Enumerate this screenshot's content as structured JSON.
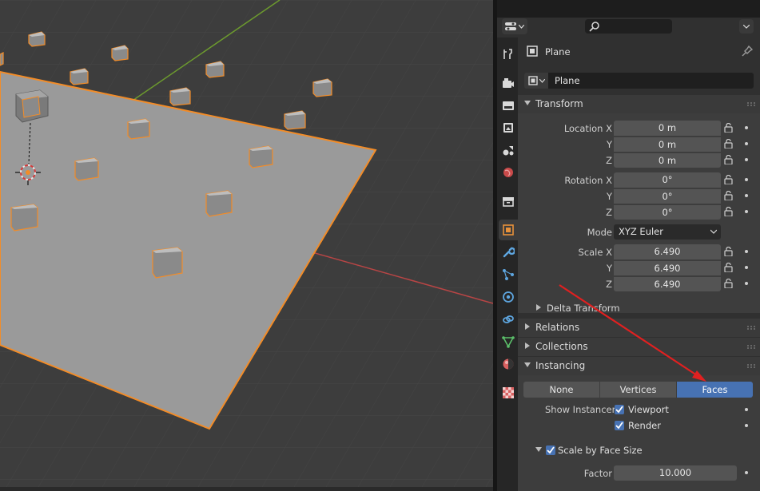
{
  "object": {
    "name": "Plane",
    "datablock_name": "Plane"
  },
  "tabs": [
    {
      "id": "tool",
      "icon": "tool-icon"
    },
    {
      "id": "render",
      "icon": "render-icon"
    },
    {
      "id": "output",
      "icon": "output-icon"
    },
    {
      "id": "view-layer",
      "icon": "view-layer-icon"
    },
    {
      "id": "scene",
      "icon": "scene-icon"
    },
    {
      "id": "world",
      "icon": "world-icon"
    },
    {
      "id": "collection",
      "icon": "collection-icon"
    },
    {
      "id": "object",
      "icon": "object-icon",
      "active": true
    },
    {
      "id": "modifiers",
      "icon": "wrench-icon"
    },
    {
      "id": "particles",
      "icon": "particles-icon"
    },
    {
      "id": "physics",
      "icon": "physics-icon"
    },
    {
      "id": "constraints",
      "icon": "constraints-icon"
    },
    {
      "id": "data",
      "icon": "mesh-data-icon"
    },
    {
      "id": "material",
      "icon": "material-icon"
    },
    {
      "id": "texture",
      "icon": "texture-icon"
    }
  ],
  "transform": {
    "title": "Transform",
    "location": {
      "label": "Location X",
      "y_label": "Y",
      "z_label": "Z",
      "x": "0 m",
      "y": "0 m",
      "z": "0 m"
    },
    "rotation": {
      "label": "Rotation X",
      "y_label": "Y",
      "z_label": "Z",
      "x": "0°",
      "y": "0°",
      "z": "0°"
    },
    "mode": {
      "label": "Mode",
      "value": "XYZ Euler"
    },
    "scale": {
      "label": "Scale X",
      "y_label": "Y",
      "z_label": "Z",
      "x": "6.490",
      "y": "6.490",
      "z": "6.490"
    },
    "delta": "Delta Transform"
  },
  "panels": {
    "relations": "Relations",
    "collections": "Collections",
    "instancing": "Instancing"
  },
  "instancing": {
    "options": [
      "None",
      "Vertices",
      "Faces"
    ],
    "selected": "Faces",
    "show_instancer_label": "Show Instancer",
    "viewport_label": "Viewport",
    "render_label": "Render",
    "scale_by_face_size": "Scale by Face Size",
    "factor_label": "Factor",
    "factor_value": "10.000"
  },
  "colors": {
    "selection_outline": "#f28c28",
    "active_button": "#4772b3",
    "annotation_arrow": "#e02020",
    "x_axis": "#d94444",
    "y_axis": "#7ab33a"
  }
}
